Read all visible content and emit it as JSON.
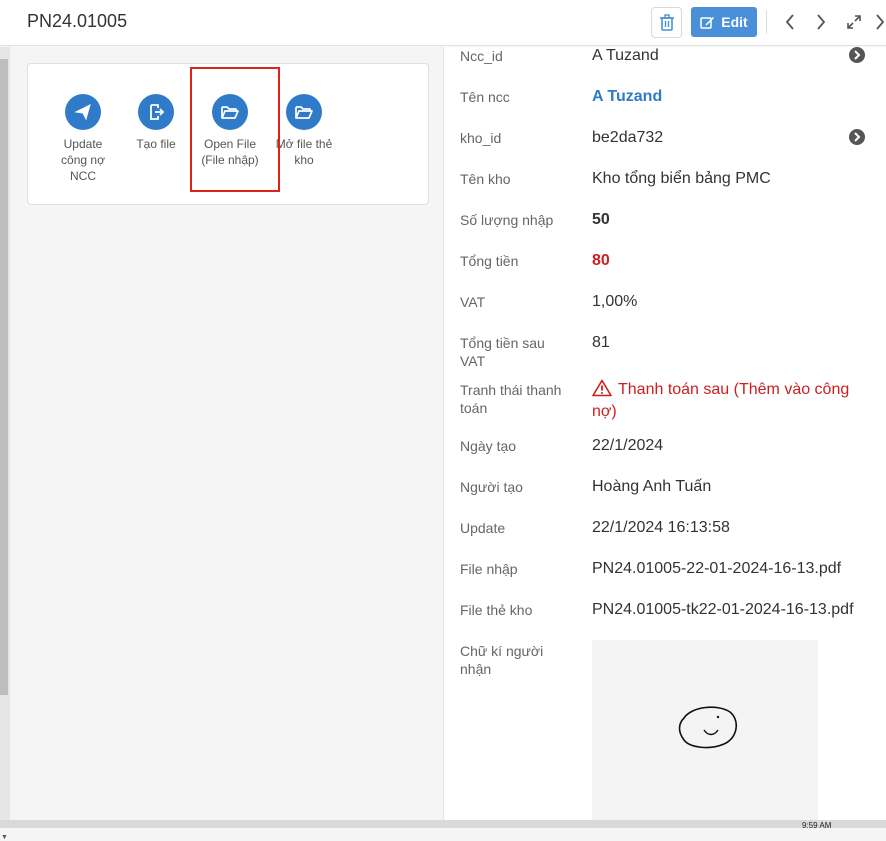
{
  "header": {
    "title": "PN24.01005",
    "edit_label": "Edit"
  },
  "actions": [
    {
      "label_lines": [
        "Update",
        "công nợ",
        "NCC"
      ],
      "icon": "send-icon"
    },
    {
      "label_lines": [
        "Tạo file"
      ],
      "icon": "export-file-icon"
    },
    {
      "label_lines": [
        "Open File",
        "(File nhập)"
      ],
      "icon": "folder-open-icon"
    },
    {
      "label_lines": [
        "Mở file thẻ",
        "kho"
      ],
      "icon": "folder-open-icon"
    }
  ],
  "details": {
    "ncc_id": {
      "label": "Ncc_id",
      "value": "A Tuzand"
    },
    "ten_ncc": {
      "label": "Tên ncc",
      "value": "A Tuzand"
    },
    "kho_id": {
      "label": "kho_id",
      "value": "be2da732"
    },
    "ten_kho": {
      "label": "Tên kho",
      "value": "Kho tổng biển bảng PMC"
    },
    "so_luong_nhap": {
      "label": "Số lượng nhập",
      "value": "50"
    },
    "tong_tien": {
      "label": "Tổng tiền",
      "value": "80"
    },
    "vat": {
      "label": "VAT",
      "value": "1,00%"
    },
    "tong_tien_sau_vat": {
      "label_lines": [
        "Tổng tiền sau",
        "VAT"
      ],
      "value": "81"
    },
    "trang_thai": {
      "label_lines": [
        "Tranh thái thanh",
        "toán"
      ],
      "value_lines": [
        "Thanh toán sau (Thêm vào công",
        "nợ)"
      ]
    },
    "ngay_tao": {
      "label": "Ngày tạo",
      "value": "22/1/2024"
    },
    "nguoi_tao": {
      "label": "Người tạo",
      "value": "Hoàng Anh Tuấn"
    },
    "update": {
      "label": "Update",
      "value": "22/1/2024 16:13:58"
    },
    "file_nhap": {
      "label": "File nhập",
      "value": "PN24.01005-22-01-2024-16-13.pdf"
    },
    "file_the_kho": {
      "label": "File thẻ kho",
      "value": "PN24.01005-tk22-01-2024-16-13.pdf"
    },
    "chu_ki": {
      "label_lines": [
        "Chữ kí người",
        "nhận"
      ]
    }
  },
  "colors": {
    "accent": "#2f7ac9",
    "edit_button": "#4a90d9",
    "danger": "#cc1f1f",
    "highlight_box": "#e0201b"
  },
  "taskbar": {
    "clock": "9:59 AM"
  }
}
